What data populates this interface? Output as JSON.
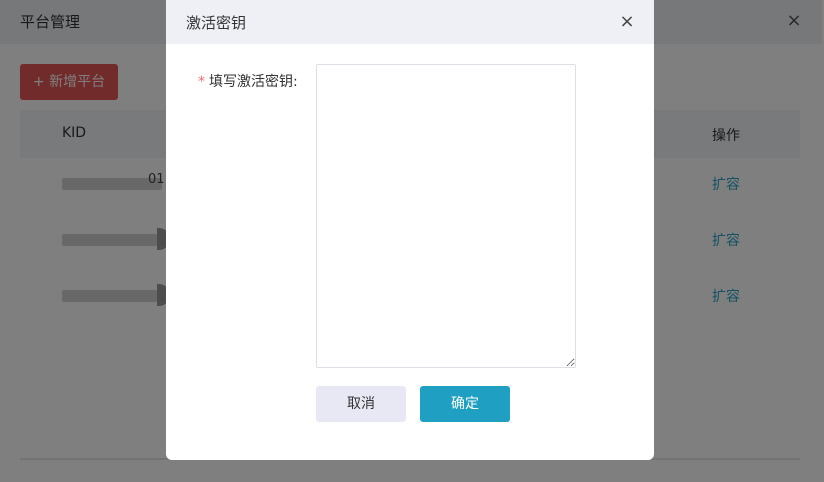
{
  "background": {
    "title": "平台管理",
    "close_icon": "×",
    "add_button": "+ 新增平台",
    "table": {
      "columns": {
        "kid": "KID",
        "op": "操作"
      },
      "rows": [
        {
          "kid_tail": "01",
          "action": "扩容"
        },
        {
          "kid_tail": "",
          "action": "扩容"
        },
        {
          "kid_tail": "",
          "action": "扩容"
        }
      ]
    }
  },
  "modal": {
    "title": "激活密钥",
    "close_icon": "×",
    "field_label": "填写激活密钥:",
    "required_mark": "*",
    "textarea_value": "",
    "cancel_label": "取消",
    "confirm_label": "确定"
  },
  "colors": {
    "primary": "#1fa0c2",
    "danger": "#e35656",
    "required": "#f56c6c",
    "header_bg": "#eef0f5"
  }
}
